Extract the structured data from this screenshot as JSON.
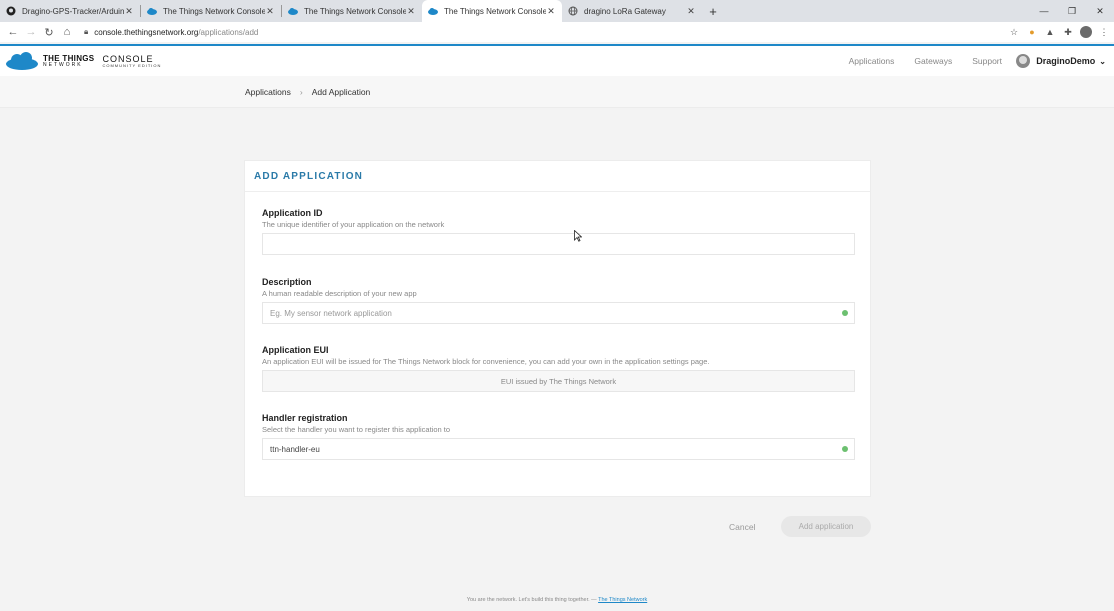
{
  "browser": {
    "tabs": [
      {
        "title": "Dragino-GPS-Tracker/Arduino Lo",
        "icon": "github-icon",
        "active": false
      },
      {
        "title": "The Things Network Console",
        "icon": "ttn-cloud-icon",
        "active": false
      },
      {
        "title": "The Things Network Console",
        "icon": "ttn-cloud-icon",
        "active": false
      },
      {
        "title": "The Things Network Console",
        "icon": "ttn-cloud-icon",
        "active": true
      },
      {
        "title": "dragino LoRa Gateway",
        "icon": "globe-icon",
        "active": false
      }
    ],
    "url_host": "console.thethingsnetwork.org",
    "url_path": "/applications/add"
  },
  "header": {
    "logo_line1": "THE THINGS",
    "logo_line2": "NETWORK",
    "console_line1": "CONSOLE",
    "console_line2": "COMMUNITY EDITION",
    "nav": [
      "Applications",
      "Gateways",
      "Support"
    ],
    "username": "DraginoDemo"
  },
  "breadcrumb": {
    "items": [
      "Applications",
      "Add Application"
    ]
  },
  "form": {
    "title": "ADD APPLICATION",
    "fields": [
      {
        "label": "Application ID",
        "hint": "The unique identifier of your application on the network",
        "value": "",
        "placeholder": ""
      },
      {
        "label": "Description",
        "hint": "A human readable description of your new app",
        "value": "",
        "placeholder": "Eg. My sensor network application"
      },
      {
        "label": "Application EUI",
        "hint": "An application EUI will be issued for The Things Network block for convenience, you can add your own in the application settings page.",
        "value": "EUI issued by The Things Network"
      },
      {
        "label": "Handler registration",
        "hint": "Select the handler you want to register this application to",
        "value": "ttn-handler-eu"
      }
    ],
    "cancel_label": "Cancel",
    "submit_label": "Add application"
  },
  "footer": {
    "text": "You are the network. Let's build this thing together. — ",
    "link": "The Things Network"
  },
  "colors": {
    "accent": "#1e88c8",
    "title": "#2a7aa8",
    "valid": "#6cc070"
  }
}
